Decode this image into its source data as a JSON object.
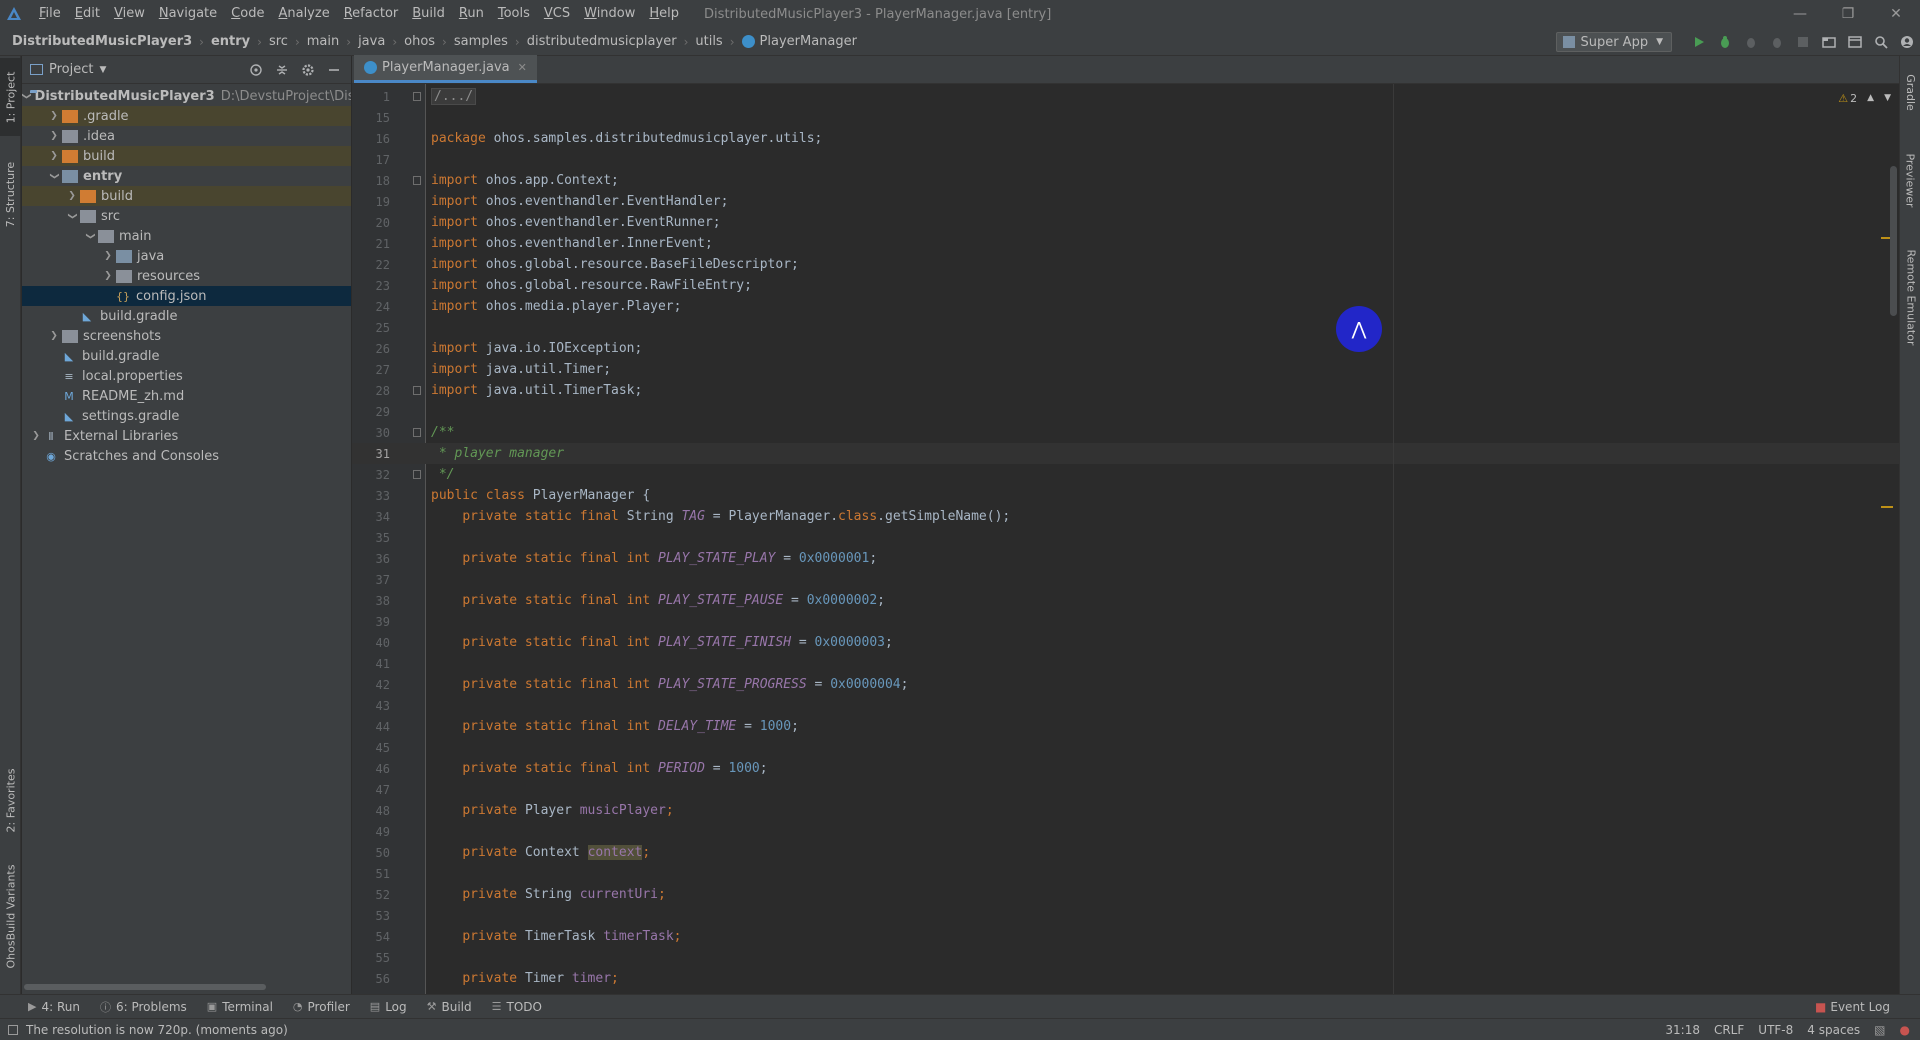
{
  "menubar": {
    "items": [
      "File",
      "Edit",
      "View",
      "Navigate",
      "Code",
      "Analyze",
      "Refactor",
      "Build",
      "Run",
      "Tools",
      "VCS",
      "Window",
      "Help"
    ],
    "window_title": "DistributedMusicPlayer3 - PlayerManager.java [entry]"
  },
  "breadcrumb": [
    "DistributedMusicPlayer3",
    "entry",
    "src",
    "main",
    "java",
    "ohos",
    "samples",
    "distributedmusicplayer",
    "utils",
    "PlayerManager"
  ],
  "run_config": {
    "label": "Super App"
  },
  "left_strip": {
    "project_tab": "1: Project",
    "structure_tab": "7: Structure",
    "favorites_tab": "2: Favorites",
    "variants_tab": "OhosBuild Variants"
  },
  "right_strip": {
    "gradle_tab": "Gradle",
    "previewer_tab": "Previewer",
    "emulator_tab": "Remote Emulator"
  },
  "project": {
    "title": "Project",
    "root_path": "D:\\DevstuProject\\Distr",
    "tree": [
      {
        "label": "DistributedMusicPlayer3",
        "indent": 0,
        "arrow": "open",
        "icon": "proj",
        "bold": true
      },
      {
        "label": ".gradle",
        "indent": 1,
        "arrow": "closed",
        "icon": "orange",
        "excluded": true
      },
      {
        "label": ".idea",
        "indent": 1,
        "arrow": "closed",
        "icon": "grey"
      },
      {
        "label": "build",
        "indent": 1,
        "arrow": "closed",
        "icon": "orange",
        "excluded": true
      },
      {
        "label": "entry",
        "indent": 1,
        "arrow": "open",
        "icon": "blue",
        "bold": true
      },
      {
        "label": "build",
        "indent": 2,
        "arrow": "closed",
        "icon": "orange",
        "excluded": true
      },
      {
        "label": "src",
        "indent": 2,
        "arrow": "open",
        "icon": "grey"
      },
      {
        "label": "main",
        "indent": 3,
        "arrow": "open",
        "icon": "grey"
      },
      {
        "label": "java",
        "indent": 4,
        "arrow": "closed",
        "icon": "blue"
      },
      {
        "label": "resources",
        "indent": 4,
        "arrow": "closed",
        "icon": "grey"
      },
      {
        "label": "config.json",
        "indent": 4,
        "arrow": "none",
        "icon": "json",
        "selected": true
      },
      {
        "label": "build.gradle",
        "indent": 2,
        "arrow": "none",
        "icon": "gradle"
      },
      {
        "label": "screenshots",
        "indent": 1,
        "arrow": "closed",
        "icon": "grey"
      },
      {
        "label": "build.gradle",
        "indent": 1,
        "arrow": "none",
        "icon": "gradle"
      },
      {
        "label": "local.properties",
        "indent": 1,
        "arrow": "none",
        "icon": "props"
      },
      {
        "label": "README_zh.md",
        "indent": 1,
        "arrow": "none",
        "icon": "md"
      },
      {
        "label": "settings.gradle",
        "indent": 1,
        "arrow": "none",
        "icon": "gradle"
      },
      {
        "label": "External Libraries",
        "indent": 0,
        "arrow": "closed",
        "icon": "libs"
      },
      {
        "label": "Scratches and Consoles",
        "indent": 0,
        "arrow": "none",
        "icon": "scratch"
      }
    ]
  },
  "editor": {
    "tab_label": "PlayerManager.java",
    "warning_count": "2",
    "current_line": "31",
    "lines": [
      {
        "n": "1",
        "fold": true,
        "parts": [
          [
            "fold",
            "/.../"
          ]
        ]
      },
      {
        "n": "15",
        "parts": []
      },
      {
        "n": "16",
        "parts": [
          [
            "kw",
            "package "
          ],
          [
            "plain",
            "ohos.samples.distributedmusicplayer.utils;"
          ]
        ]
      },
      {
        "n": "17",
        "parts": []
      },
      {
        "n": "18",
        "fold": true,
        "parts": [
          [
            "kw",
            "import "
          ],
          [
            "plain",
            "ohos.app.Context;"
          ]
        ]
      },
      {
        "n": "19",
        "parts": [
          [
            "kw",
            "import "
          ],
          [
            "plain",
            "ohos.eventhandler.EventHandler;"
          ]
        ]
      },
      {
        "n": "20",
        "parts": [
          [
            "kw",
            "import "
          ],
          [
            "plain",
            "ohos.eventhandler.EventRunner;"
          ]
        ]
      },
      {
        "n": "21",
        "parts": [
          [
            "kw",
            "import "
          ],
          [
            "plain",
            "ohos.eventhandler.InnerEvent;"
          ]
        ]
      },
      {
        "n": "22",
        "parts": [
          [
            "kw",
            "import "
          ],
          [
            "plain",
            "ohos.global.resource.BaseFileDescriptor;"
          ]
        ]
      },
      {
        "n": "23",
        "parts": [
          [
            "kw",
            "import "
          ],
          [
            "plain",
            "ohos.global.resource.RawFileEntry;"
          ]
        ]
      },
      {
        "n": "24",
        "parts": [
          [
            "kw",
            "import "
          ],
          [
            "plain",
            "ohos.media.player.Player;"
          ]
        ]
      },
      {
        "n": "25",
        "parts": []
      },
      {
        "n": "26",
        "parts": [
          [
            "kw",
            "import "
          ],
          [
            "plain",
            "java.io.IOException;"
          ]
        ]
      },
      {
        "n": "27",
        "parts": [
          [
            "kw",
            "import "
          ],
          [
            "plain",
            "java.util.Timer;"
          ]
        ]
      },
      {
        "n": "28",
        "fold": true,
        "parts": [
          [
            "kw",
            "import "
          ],
          [
            "plain",
            "java.util.TimerTask;"
          ]
        ]
      },
      {
        "n": "29",
        "parts": []
      },
      {
        "n": "30",
        "fold": true,
        "parts": [
          [
            "cm",
            "/**"
          ]
        ]
      },
      {
        "n": "31",
        "parts": [
          [
            "cm",
            " * player manager"
          ]
        ]
      },
      {
        "n": "32",
        "fold": true,
        "parts": [
          [
            "cm",
            " */"
          ]
        ]
      },
      {
        "n": "33",
        "parts": [
          [
            "kw",
            "public class "
          ],
          [
            "plain",
            "PlayerManager {"
          ]
        ]
      },
      {
        "n": "34",
        "parts": [
          [
            "plain",
            "    "
          ],
          [
            "kw",
            "private static final "
          ],
          [
            "plain",
            "String "
          ],
          [
            "fldi",
            "TAG"
          ],
          [
            "plain",
            " = PlayerManager."
          ],
          [
            "kw",
            "class"
          ],
          [
            "plain",
            ".getSimpleName();"
          ]
        ]
      },
      {
        "n": "35",
        "parts": []
      },
      {
        "n": "36",
        "parts": [
          [
            "plain",
            "    "
          ],
          [
            "kw",
            "private static final int "
          ],
          [
            "fldi",
            "PLAY_STATE_PLAY"
          ],
          [
            "plain",
            " = "
          ],
          [
            "num",
            "0x0000001"
          ],
          [
            "plain",
            ";"
          ]
        ]
      },
      {
        "n": "37",
        "parts": []
      },
      {
        "n": "38",
        "parts": [
          [
            "plain",
            "    "
          ],
          [
            "kw",
            "private static final int "
          ],
          [
            "fldi",
            "PLAY_STATE_PAUSE"
          ],
          [
            "plain",
            " = "
          ],
          [
            "num",
            "0x0000002"
          ],
          [
            "plain",
            ";"
          ]
        ]
      },
      {
        "n": "39",
        "parts": []
      },
      {
        "n": "40",
        "parts": [
          [
            "plain",
            "    "
          ],
          [
            "kw",
            "private static final int "
          ],
          [
            "fldi",
            "PLAY_STATE_FINISH"
          ],
          [
            "plain",
            " = "
          ],
          [
            "num",
            "0x0000003"
          ],
          [
            "plain",
            ";"
          ]
        ]
      },
      {
        "n": "41",
        "parts": []
      },
      {
        "n": "42",
        "parts": [
          [
            "plain",
            "    "
          ],
          [
            "kw",
            "private static final int "
          ],
          [
            "fldi",
            "PLAY_STATE_PROGRESS"
          ],
          [
            "plain",
            " = "
          ],
          [
            "num",
            "0x0000004"
          ],
          [
            "plain",
            ";"
          ]
        ]
      },
      {
        "n": "43",
        "parts": []
      },
      {
        "n": "44",
        "parts": [
          [
            "plain",
            "    "
          ],
          [
            "kw",
            "private static final int "
          ],
          [
            "fldi",
            "DELAY_TIME"
          ],
          [
            "plain",
            " = "
          ],
          [
            "num",
            "1000"
          ],
          [
            "plain",
            ";"
          ]
        ]
      },
      {
        "n": "45",
        "parts": []
      },
      {
        "n": "46",
        "parts": [
          [
            "plain",
            "    "
          ],
          [
            "kw",
            "private static final int "
          ],
          [
            "fldi",
            "PERIOD"
          ],
          [
            "plain",
            " = "
          ],
          [
            "num",
            "1000"
          ],
          [
            "plain",
            ";"
          ]
        ]
      },
      {
        "n": "47",
        "parts": []
      },
      {
        "n": "48",
        "parts": [
          [
            "plain",
            "    "
          ],
          [
            "kw",
            "private "
          ],
          [
            "plain",
            "Player "
          ],
          [
            "fld",
            "musicPlayer"
          ],
          [
            "kw",
            ";"
          ]
        ]
      },
      {
        "n": "49",
        "parts": []
      },
      {
        "n": "50",
        "parts": [
          [
            "plain",
            "    "
          ],
          [
            "kw",
            "private "
          ],
          [
            "plain",
            "Context "
          ],
          [
            "hl",
            "context"
          ],
          [
            "kw",
            ";"
          ]
        ]
      },
      {
        "n": "51",
        "parts": []
      },
      {
        "n": "52",
        "parts": [
          [
            "plain",
            "    "
          ],
          [
            "kw",
            "private "
          ],
          [
            "plain",
            "String "
          ],
          [
            "fld",
            "currentUri"
          ],
          [
            "kw",
            ";"
          ]
        ]
      },
      {
        "n": "53",
        "parts": []
      },
      {
        "n": "54",
        "parts": [
          [
            "plain",
            "    "
          ],
          [
            "kw",
            "private "
          ],
          [
            "plain",
            "TimerTask "
          ],
          [
            "fld",
            "timerTask"
          ],
          [
            "kw",
            ";"
          ]
        ]
      },
      {
        "n": "55",
        "parts": []
      },
      {
        "n": "56",
        "parts": [
          [
            "plain",
            "    "
          ],
          [
            "kw",
            "private "
          ],
          [
            "plain",
            "Timer "
          ],
          [
            "fld",
            "timer"
          ],
          [
            "kw",
            ";"
          ]
        ]
      }
    ]
  },
  "bottom_tools": [
    {
      "icon": "run-icon",
      "label": "4: Run"
    },
    {
      "icon": "problems-icon",
      "label": "6: Problems"
    },
    {
      "icon": "terminal-icon",
      "label": "Terminal"
    },
    {
      "icon": "profiler-icon",
      "label": "Profiler"
    },
    {
      "icon": "log-icon",
      "label": "Log"
    },
    {
      "icon": "build-icon",
      "label": "Build"
    },
    {
      "icon": "todo-icon",
      "label": "TODO"
    }
  ],
  "event_log": "Event Log",
  "status": {
    "message": "The resolution is now 720p. (moments ago)",
    "position": "31:18",
    "line_sep": "CRLF",
    "encoding": "UTF-8",
    "indent": "4 spaces"
  },
  "colors": {
    "accent": "#4a88c7",
    "keyword": "#cc7832",
    "comment": "#629755",
    "number": "#6897bb",
    "field": "#9876aa",
    "cursor_blob": "#2226c8"
  }
}
